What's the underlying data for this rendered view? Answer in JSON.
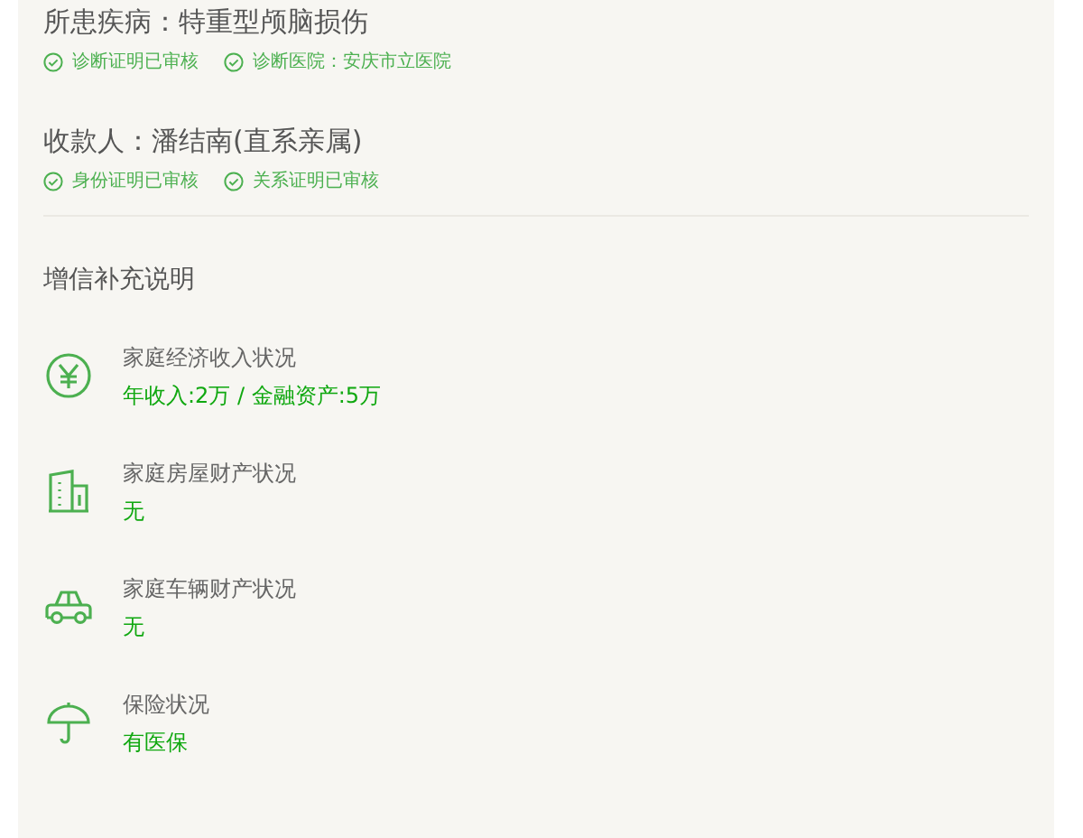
{
  "verification": [
    {
      "title": "所患疾病：特重型颅脑损伤",
      "tags": [
        "诊断证明已审核",
        "诊断医院：安庆市立医院"
      ]
    },
    {
      "title": "收款人：潘结南(直系亲属)",
      "tags": [
        "身份证明已审核",
        "关系证明已审核"
      ]
    }
  ],
  "supplement": {
    "heading": "增信补充说明",
    "items": [
      {
        "kind": "money",
        "label": "家庭经济收入状况",
        "value": "年收入:2万 / 金融资产:5万"
      },
      {
        "kind": "house",
        "label": "家庭房屋财产状况",
        "value": "无"
      },
      {
        "kind": "car",
        "label": "家庭车辆财产状况",
        "value": "无"
      },
      {
        "kind": "umbrella",
        "label": "保险状况",
        "value": "有医保"
      }
    ]
  }
}
